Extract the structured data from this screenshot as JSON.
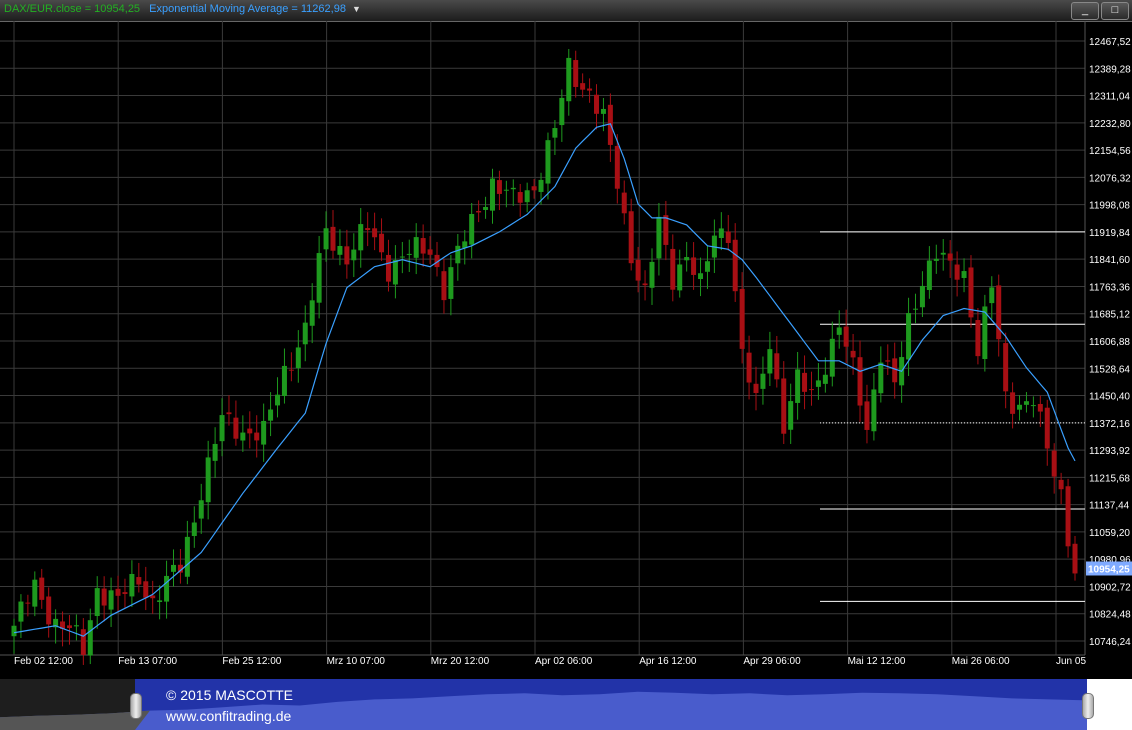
{
  "legend": {
    "close_text": "DAX/EUR.close = 10954,25",
    "ema_text": "Exponential Moving Average = 11262,98",
    "dropdown_icon": "chevron-down-icon"
  },
  "window_buttons": {
    "minimize": "_",
    "maximize": "□"
  },
  "colors": {
    "up": "#1e9a1e",
    "down": "#a80f14",
    "ema": "#3aa0ff",
    "grid": "#3a3a3a",
    "axis_text": "#ffffff",
    "price_tag": "#7faaff"
  },
  "chart_data": {
    "type": "candlestick",
    "ylim": [
      10746.24,
      12467.52
    ],
    "y_ticks": [
      "12467,52",
      "12389,28",
      "12311,04",
      "12232,80",
      "12154,56",
      "12076,32",
      "11998,08",
      "11919,84",
      "11841,60",
      "11763,36",
      "11685,12",
      "11606,88",
      "11528,64",
      "11450,40",
      "11372,16",
      "11293,92",
      "11215,68",
      "11137,44",
      "11059,20",
      "10980,96",
      "10902,72",
      "10824,48",
      "10746,24"
    ],
    "x_ticks": [
      "Feb 02 12:00",
      "Feb 13 07:00",
      "Feb 25 12:00",
      "Mrz 10 07:00",
      "Mrz 20 12:00",
      "Apr 02 06:00",
      "Apr 16 12:00",
      "Apr 29 06:00",
      "Mai 12 12:00",
      "Mai 26 06:00",
      "Jun 05"
    ],
    "last_price_label": "10954,25",
    "horizontal_lines": [
      11919.84,
      11655,
      11372.16,
      11125,
      10860
    ],
    "close_anchors": [
      [
        0,
        10790
      ],
      [
        3,
        10900
      ],
      [
        6,
        10800
      ],
      [
        8,
        10780
      ],
      [
        10,
        10720
      ],
      [
        12,
        10900
      ],
      [
        15,
        10860
      ],
      [
        18,
        10930
      ],
      [
        20,
        10860
      ],
      [
        24,
        10960
      ],
      [
        27,
        11180
      ],
      [
        30,
        11380
      ],
      [
        33,
        11350
      ],
      [
        36,
        11340
      ],
      [
        39,
        11520
      ],
      [
        42,
        11640
      ],
      [
        45,
        11920
      ],
      [
        48,
        11850
      ],
      [
        51,
        11930
      ],
      [
        54,
        11820
      ],
      [
        57,
        11860
      ],
      [
        60,
        11870
      ],
      [
        62,
        11760
      ],
      [
        65,
        11900
      ],
      [
        67,
        11990
      ],
      [
        69,
        12060
      ],
      [
        72,
        12010
      ],
      [
        75,
        12050
      ],
      [
        78,
        12210
      ],
      [
        80,
        12390
      ],
      [
        83,
        12320
      ],
      [
        85,
        12240
      ],
      [
        87,
        12060
      ],
      [
        89,
        11860
      ],
      [
        91,
        11740
      ],
      [
        93,
        11940
      ],
      [
        95,
        11790
      ],
      [
        97,
        11860
      ],
      [
        99,
        11760
      ],
      [
        101,
        11910
      ],
      [
        103,
        11930
      ],
      [
        105,
        11570
      ],
      [
        107,
        11420
      ],
      [
        109,
        11610
      ],
      [
        111,
        11370
      ],
      [
        113,
        11490
      ],
      [
        115,
        11450
      ],
      [
        117,
        11550
      ],
      [
        119,
        11650
      ],
      [
        121,
        11520
      ],
      [
        123,
        11360
      ],
      [
        125,
        11580
      ],
      [
        127,
        11470
      ],
      [
        129,
        11660
      ],
      [
        131,
        11790
      ],
      [
        133,
        11860
      ],
      [
        135,
        11810
      ],
      [
        137,
        11800
      ],
      [
        139,
        11590
      ],
      [
        141,
        11760
      ],
      [
        143,
        11440
      ],
      [
        145,
        11430
      ],
      [
        147,
        11440
      ],
      [
        149,
        11290
      ],
      [
        151,
        11170
      ],
      [
        153,
        10940
      ]
    ],
    "ema_anchors": [
      [
        0,
        10770
      ],
      [
        6,
        10790
      ],
      [
        10,
        10760
      ],
      [
        14,
        10820
      ],
      [
        20,
        10880
      ],
      [
        27,
        11000
      ],
      [
        33,
        11170
      ],
      [
        38,
        11300
      ],
      [
        42,
        11400
      ],
      [
        45,
        11600
      ],
      [
        48,
        11760
      ],
      [
        52,
        11820
      ],
      [
        56,
        11840
      ],
      [
        60,
        11820
      ],
      [
        63,
        11860
      ],
      [
        66,
        11880
      ],
      [
        70,
        11920
      ],
      [
        74,
        11970
      ],
      [
        78,
        12050
      ],
      [
        81,
        12160
      ],
      [
        84,
        12220
      ],
      [
        86,
        12230
      ],
      [
        88,
        12130
      ],
      [
        90,
        12000
      ],
      [
        92,
        11960
      ],
      [
        94,
        11960
      ],
      [
        97,
        11940
      ],
      [
        100,
        11880
      ],
      [
        103,
        11870
      ],
      [
        105,
        11840
      ],
      [
        107,
        11790
      ],
      [
        110,
        11710
      ],
      [
        113,
        11630
      ],
      [
        116,
        11550
      ],
      [
        119,
        11550
      ],
      [
        122,
        11520
      ],
      [
        125,
        11540
      ],
      [
        128,
        11520
      ],
      [
        131,
        11610
      ],
      [
        134,
        11680
      ],
      [
        137,
        11700
      ],
      [
        140,
        11690
      ],
      [
        143,
        11620
      ],
      [
        146,
        11530
      ],
      [
        149,
        11460
      ],
      [
        152,
        11300
      ],
      [
        153,
        11263
      ]
    ]
  },
  "navigator": {
    "line1": "© 2015 MASCOTTE",
    "line2": "www.confitrading.de",
    "profile": [
      0.25,
      0.28,
      0.3,
      0.33,
      0.38,
      0.4,
      0.45,
      0.5,
      0.48,
      0.55,
      0.6,
      0.62,
      0.66,
      0.7,
      0.72,
      0.68,
      0.7,
      0.75,
      0.73,
      0.7,
      0.72,
      0.68,
      0.7,
      0.73,
      0.72,
      0.7,
      0.66,
      0.62,
      0.6,
      0.58
    ]
  }
}
